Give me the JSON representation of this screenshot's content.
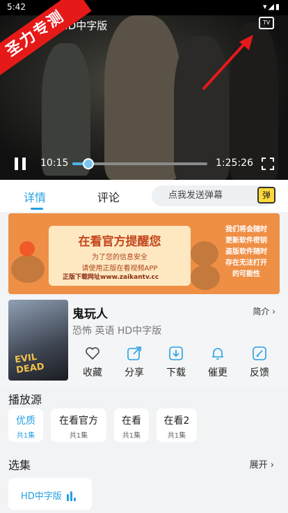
{
  "status": {
    "time": "5:42",
    "icons": "▾◢▮"
  },
  "player": {
    "title_partial": "人-HD中字版",
    "corner_banner": "圣力专测",
    "tv_label": "TV",
    "current_time": "10:15",
    "total_time": "1:25:26",
    "progress": 0.12
  },
  "tabs": {
    "details": "详情",
    "comments": "评论",
    "danmaku_placeholder": "点我发送弹幕",
    "danmaku_icon": "弹"
  },
  "ad": {
    "title": "在看官方提醒您",
    "line1": "为了您的信息安全",
    "line2": "请使用正版在看视频APP",
    "site": "正版下载网址www.zaikantv.cc",
    "right_text": [
      "我们将会随时",
      "更新软件密钥",
      "盗版软件随时",
      "存在无法打开",
      "的可能性"
    ]
  },
  "movie": {
    "poster_text": "EVIL DEAD",
    "title": "鬼玩人",
    "intro": "简介",
    "meta": "恐怖 英语 HD中字版",
    "actions": [
      {
        "label": "收藏",
        "icon": "heart-icon"
      },
      {
        "label": "分享",
        "icon": "share-icon"
      },
      {
        "label": "下载",
        "icon": "download-icon"
      },
      {
        "label": "催更",
        "icon": "bell-icon"
      },
      {
        "label": "反馈",
        "icon": "feedback-icon"
      }
    ]
  },
  "sources": {
    "title": "播放源",
    "items": [
      {
        "name": "优质",
        "count": "共1集"
      },
      {
        "name": "在看官方",
        "count": "共1集"
      },
      {
        "name": "在看",
        "count": "共1集"
      },
      {
        "name": "在看2",
        "count": "共1集"
      }
    ]
  },
  "episodes": {
    "title": "选集",
    "expand": "展开",
    "items": [
      {
        "name": "HD中字版"
      }
    ]
  },
  "colors": {
    "accent": "#27a0e3",
    "ad_bg": "#ef8f45",
    "corner_red": "#e61919"
  }
}
